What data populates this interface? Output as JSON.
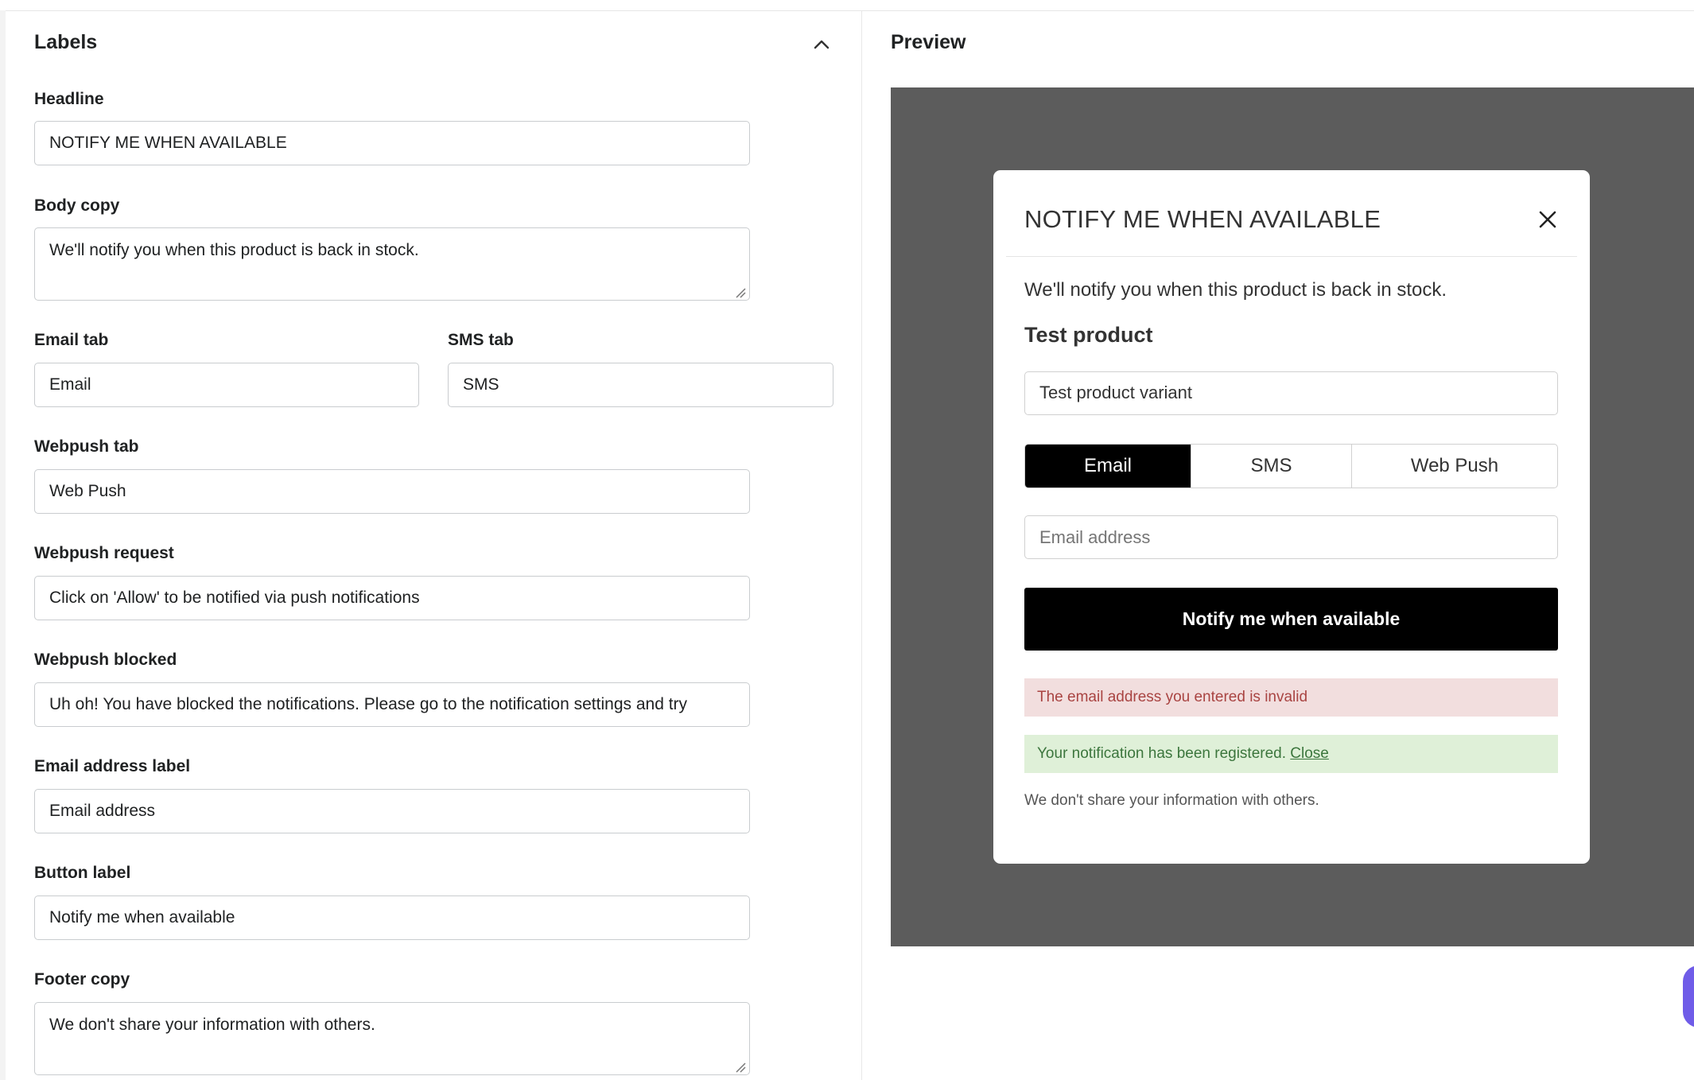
{
  "labels_panel": {
    "title": "Labels",
    "fields": {
      "headline": {
        "label": "Headline",
        "value": "NOTIFY ME WHEN AVAILABLE"
      },
      "body_copy": {
        "label": "Body copy",
        "value": "We'll notify you when this product is back in stock."
      },
      "email_tab": {
        "label": "Email tab",
        "value": "Email"
      },
      "sms_tab": {
        "label": "SMS tab",
        "value": "SMS"
      },
      "webpush_tab": {
        "label": "Webpush tab",
        "value": "Web Push"
      },
      "webpush_request": {
        "label": "Webpush request",
        "value": "Click on 'Allow' to be notified via push notifications"
      },
      "webpush_blocked": {
        "label": "Webpush blocked",
        "value": "Uh oh! You have blocked the notifications. Please go to the notification settings and try"
      },
      "email_address_label": {
        "label": "Email address label",
        "value": "Email address"
      },
      "button_label": {
        "label": "Button label",
        "value": "Notify me when available"
      },
      "footer_copy": {
        "label": "Footer copy",
        "value": "We don't share your information with others."
      }
    }
  },
  "preview": {
    "title": "Preview",
    "modal": {
      "title": "NOTIFY ME WHEN AVAILABLE",
      "body": "We'll notify you when this product is back in stock.",
      "product_name": "Test product",
      "variant": "Test product variant",
      "tabs": [
        "Email",
        "SMS",
        "Web Push"
      ],
      "active_tab": "Email",
      "email_placeholder": "Email address",
      "button_label": "Notify me when available",
      "error_message": "The email address you entered is invalid",
      "success_message": "Your notification has been registered.",
      "success_link": "Close",
      "footer": "We don't share your information with others."
    }
  },
  "colors": {
    "overlay": "#5c5c5c",
    "button": "#000000",
    "error_bg": "#f2dede",
    "error_text": "#a94442",
    "success_bg": "#dff0d8",
    "success_text": "#3c763d",
    "chat_bubble": "#6f5ce8"
  },
  "icons": {
    "collapse": "chevron-up-icon",
    "close": "close-icon",
    "resize": "resize-handle-icon"
  }
}
